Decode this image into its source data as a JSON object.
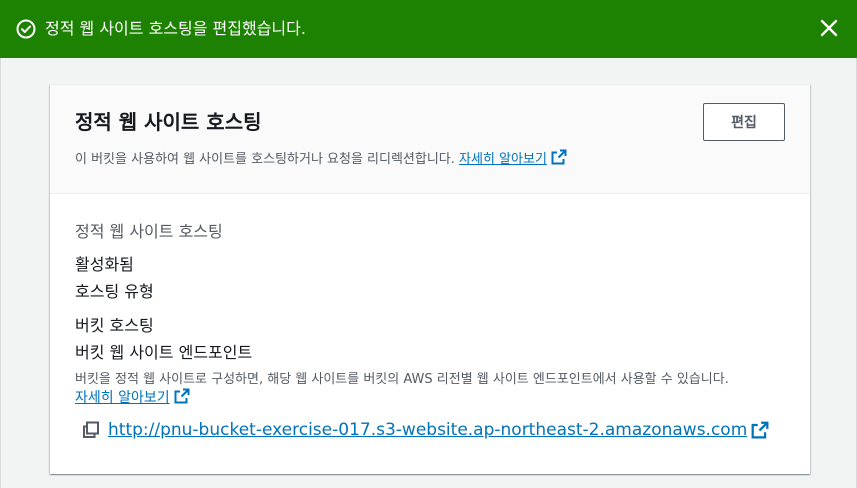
{
  "flash": {
    "message": "정적 웹 사이트 호스팅을 편집했습니다.",
    "status_icon": "check-circle-icon",
    "close_icon": "close-icon",
    "color": "#1d8102"
  },
  "card": {
    "title": "정적 웹 사이트 호스팅",
    "description": "이 버킷을 사용하여 웹 사이트를 호스팅하거나 요청을 리디렉션합니다.",
    "learn_more": "자세히 알아보기",
    "edit_button": "편집"
  },
  "body": {
    "field1_label": "정적 웹 사이트 호스팅",
    "field1_value": "활성화됨",
    "field2_label": "호스팅 유형",
    "field2_value": "버킷 호스팅",
    "field3_label": "버킷 웹 사이트 엔드포인트",
    "field3_help": "버킷을 정적 웹 사이트로 구성하면, 해당 웹 사이트를 버킷의 AWS 리전별 웹 사이트 엔드포인트에서 사용할 수 있습니다.",
    "field3_learn_more": "자세히 알아보기",
    "endpoint_url": "http://pnu-bucket-exercise-017.s3-website.ap-northeast-2.amazonaws.com"
  },
  "colors": {
    "link": "#0073bb",
    "success": "#1d8102"
  }
}
